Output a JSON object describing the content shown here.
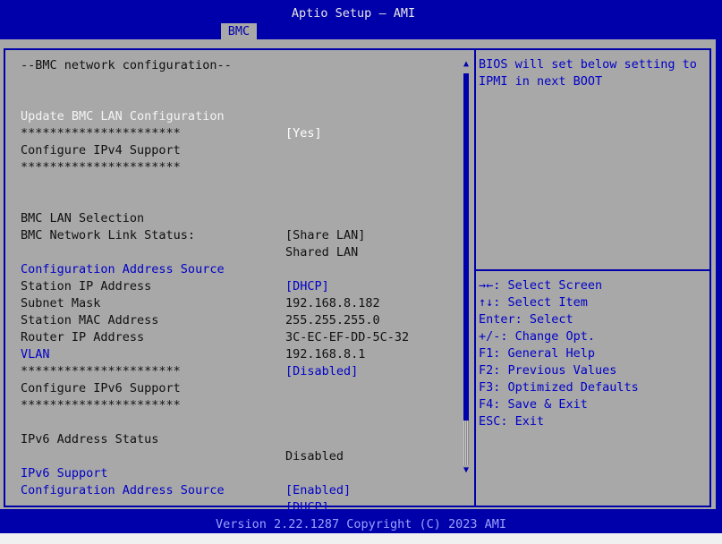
{
  "header": {
    "title": "Aptio Setup – AMI",
    "tabs": [
      {
        "label": "BMC",
        "active": true
      }
    ]
  },
  "left": {
    "section_title": "--BMC network configuration--",
    "update_bmc": {
      "label": "Update BMC LAN Configuration",
      "value": "[Yes]"
    },
    "stars_1": "**********************",
    "ipv4_header": "Configure IPv4 Support",
    "stars_2": "**********************",
    "lan_selection": {
      "label": "BMC LAN Selection",
      "value": "[Share LAN]"
    },
    "link_status": {
      "label": "BMC Network Link Status:",
      "value": "Shared LAN"
    },
    "config_source_v4": {
      "label": "Configuration Address Source",
      "value": "[DHCP]"
    },
    "station_ip": {
      "label": "Station IP Address",
      "value": "192.168.8.182"
    },
    "subnet_mask": {
      "label": "Subnet Mask",
      "value": "255.255.255.0"
    },
    "station_mac": {
      "label": "Station MAC Address",
      "value": "3C-EC-EF-DD-5C-32"
    },
    "router_ip": {
      "label": "Router IP Address",
      "value": "192.168.8.1"
    },
    "vlan": {
      "label": "VLAN",
      "value": "[Disabled]"
    },
    "stars_3": "**********************",
    "ipv6_header": "Configure IPv6 Support",
    "stars_4": "**********************",
    "ipv6_status": {
      "label": "IPv6 Address Status",
      "value": "Disabled"
    },
    "ipv6_support": {
      "label": "IPv6 Support",
      "value": "[Enabled]"
    },
    "config_source_v6": {
      "label": "Configuration Address Source",
      "value": "[DHCP]"
    }
  },
  "help": {
    "text": "BIOS will set below setting to IPMI in next BOOT"
  },
  "keys": [
    "→←: Select Screen",
    "↑↓: Select Item",
    "Enter: Select",
    "+/-: Change Opt.",
    "F1: General Help",
    "F2: Previous Values",
    "F3: Optimized Defaults",
    "F4: Save & Exit",
    "ESC: Exit"
  ],
  "scrollbar": {
    "up_arrow": "▲",
    "down_arrow": "▼"
  },
  "footer": {
    "version": "Version 2.22.1287 Copyright (C) 2023 AMI"
  },
  "colors": {
    "background": "#0000aa",
    "panel": "#a8a8a8",
    "highlight": "#ffffff",
    "option_text": "#0000c8"
  }
}
